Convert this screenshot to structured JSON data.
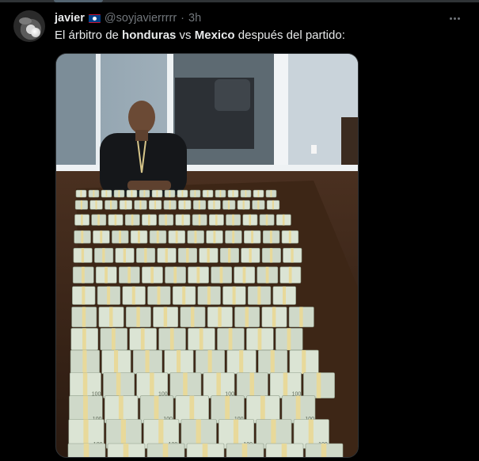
{
  "tweet": {
    "author_name": "javier",
    "handle": "@soyjavierrrrr",
    "separator": "·",
    "time": "3h",
    "text_before": "El árbitro de ",
    "text_bold_1": "honduras",
    "text_middle": " vs ",
    "text_bold_2": "Mexico",
    "text_after": " después del partido:",
    "more_icon": "more-horizontal-icon",
    "flag_icon": "belize-flag-icon"
  },
  "media": {
    "bill_label": "100"
  },
  "colors": {
    "background": "#000000",
    "text": "#e7e9ea",
    "muted": "#71767b",
    "border": "#2f3336"
  }
}
